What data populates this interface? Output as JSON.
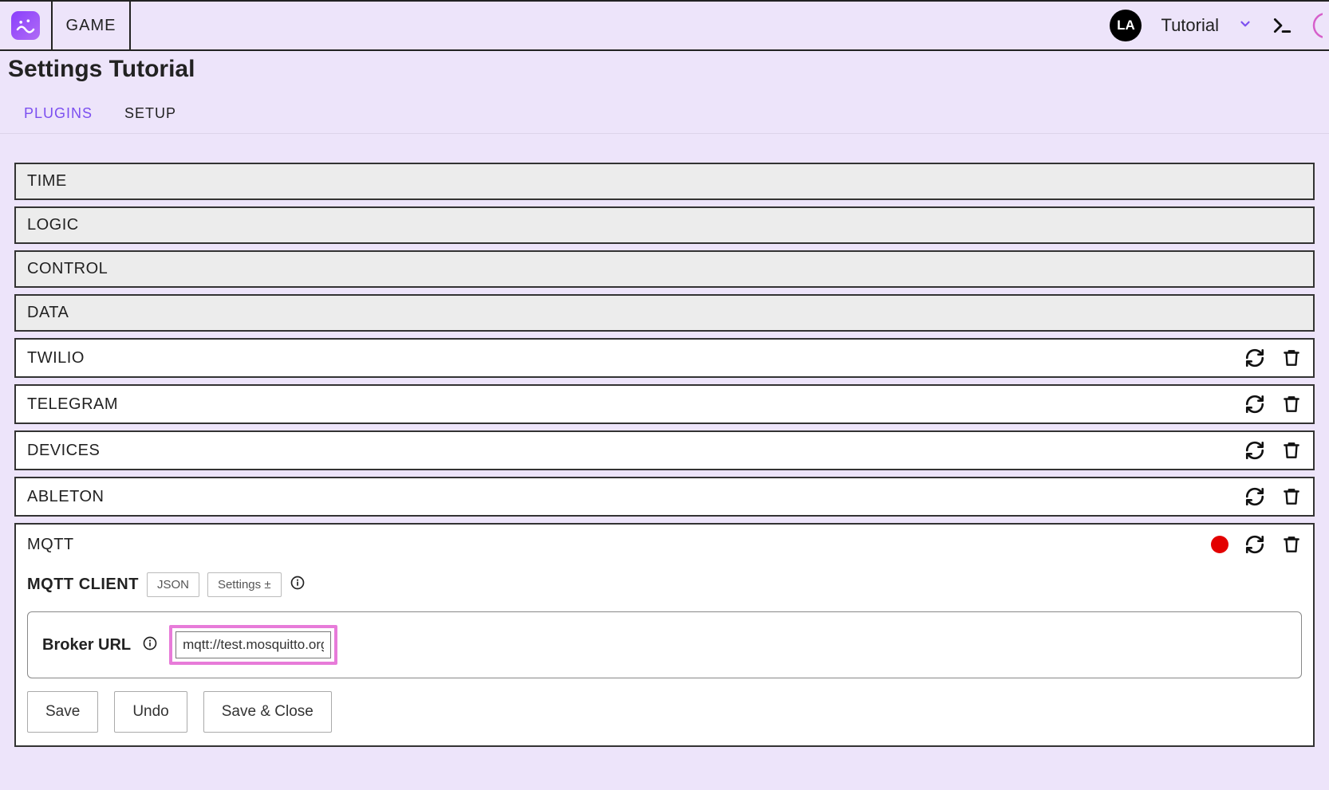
{
  "topbar": {
    "game_label": "GAME",
    "avatar_initials": "LA",
    "project_name": "Tutorial"
  },
  "page": {
    "title": "Settings Tutorial"
  },
  "tabs": {
    "plugins": "PLUGINS",
    "setup": "SETUP"
  },
  "core_plugins": [
    {
      "name": "TIME"
    },
    {
      "name": "LOGIC"
    },
    {
      "name": "CONTROL"
    },
    {
      "name": "DATA"
    }
  ],
  "user_plugins": [
    {
      "name": "TWILIO"
    },
    {
      "name": "TELEGRAM"
    },
    {
      "name": "DEVICES"
    },
    {
      "name": "ABLETON"
    }
  ],
  "mqtt": {
    "name": "MQTT",
    "client_heading": "MQTT CLIENT",
    "json_btn": "JSON",
    "settings_btn": "Settings ±",
    "broker_label": "Broker URL",
    "broker_value": "mqtt://test.mosquitto.org",
    "save_btn": "Save",
    "undo_btn": "Undo",
    "save_close_btn": "Save & Close"
  }
}
